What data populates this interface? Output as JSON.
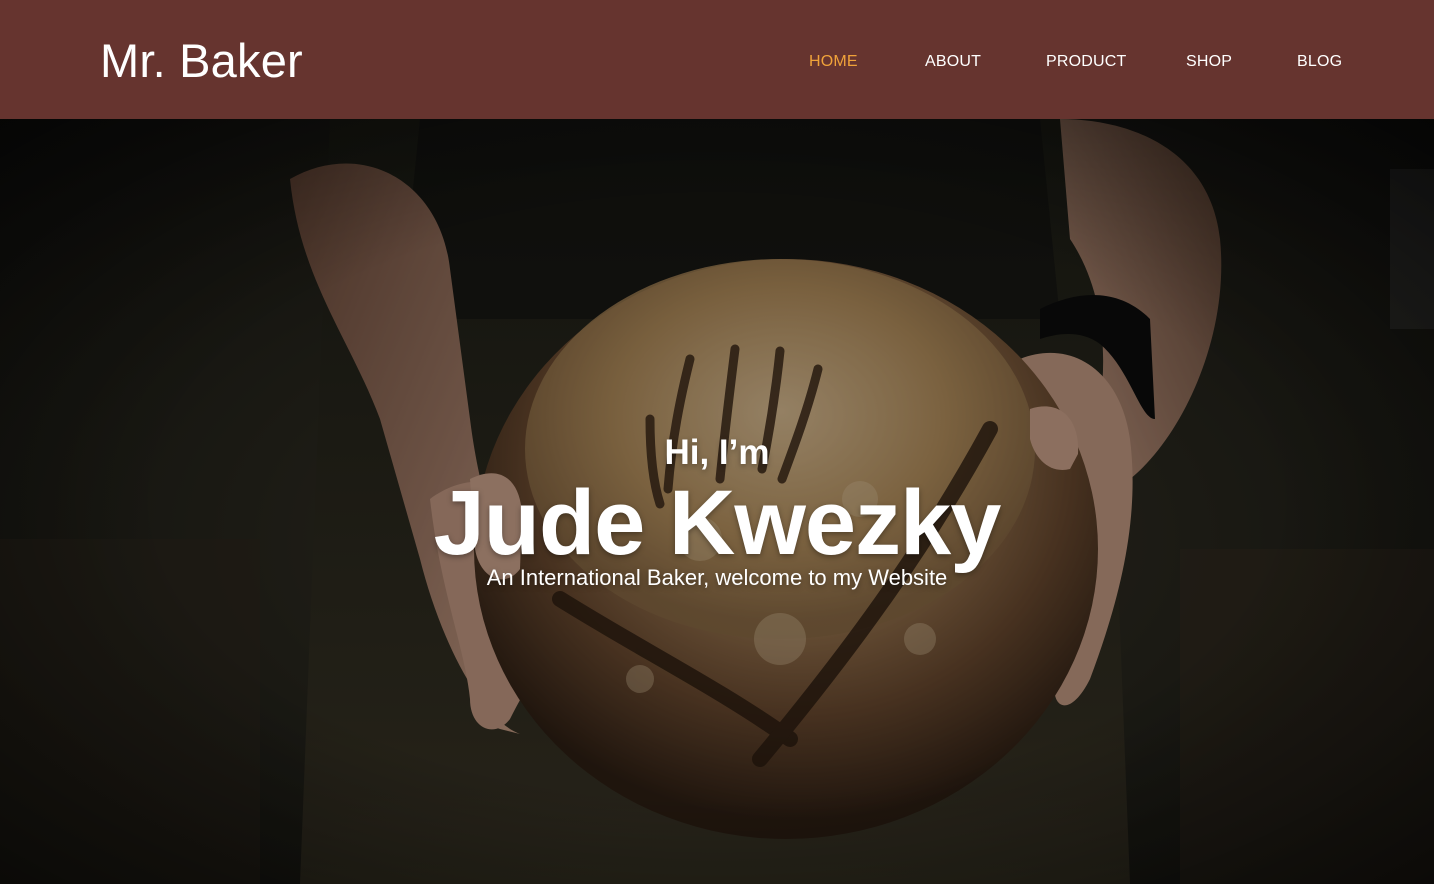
{
  "header": {
    "brand": "Mr. Baker",
    "nav": [
      {
        "label": "HOME",
        "active": true
      },
      {
        "label": "ABOUT",
        "active": false
      },
      {
        "label": "PRODUCT",
        "active": false
      },
      {
        "label": "SHOP",
        "active": false
      },
      {
        "label": "BLOG",
        "active": false
      }
    ]
  },
  "hero": {
    "greeting": "Hi, I’m",
    "name": "Jude Kwezky",
    "tagline": "An International Baker, welcome to my Website",
    "image": "baker-holding-sourdough-loaf"
  },
  "colors": {
    "header_bg": "#66342f",
    "nav_active": "#f0a23a",
    "text": "#ffffff"
  }
}
